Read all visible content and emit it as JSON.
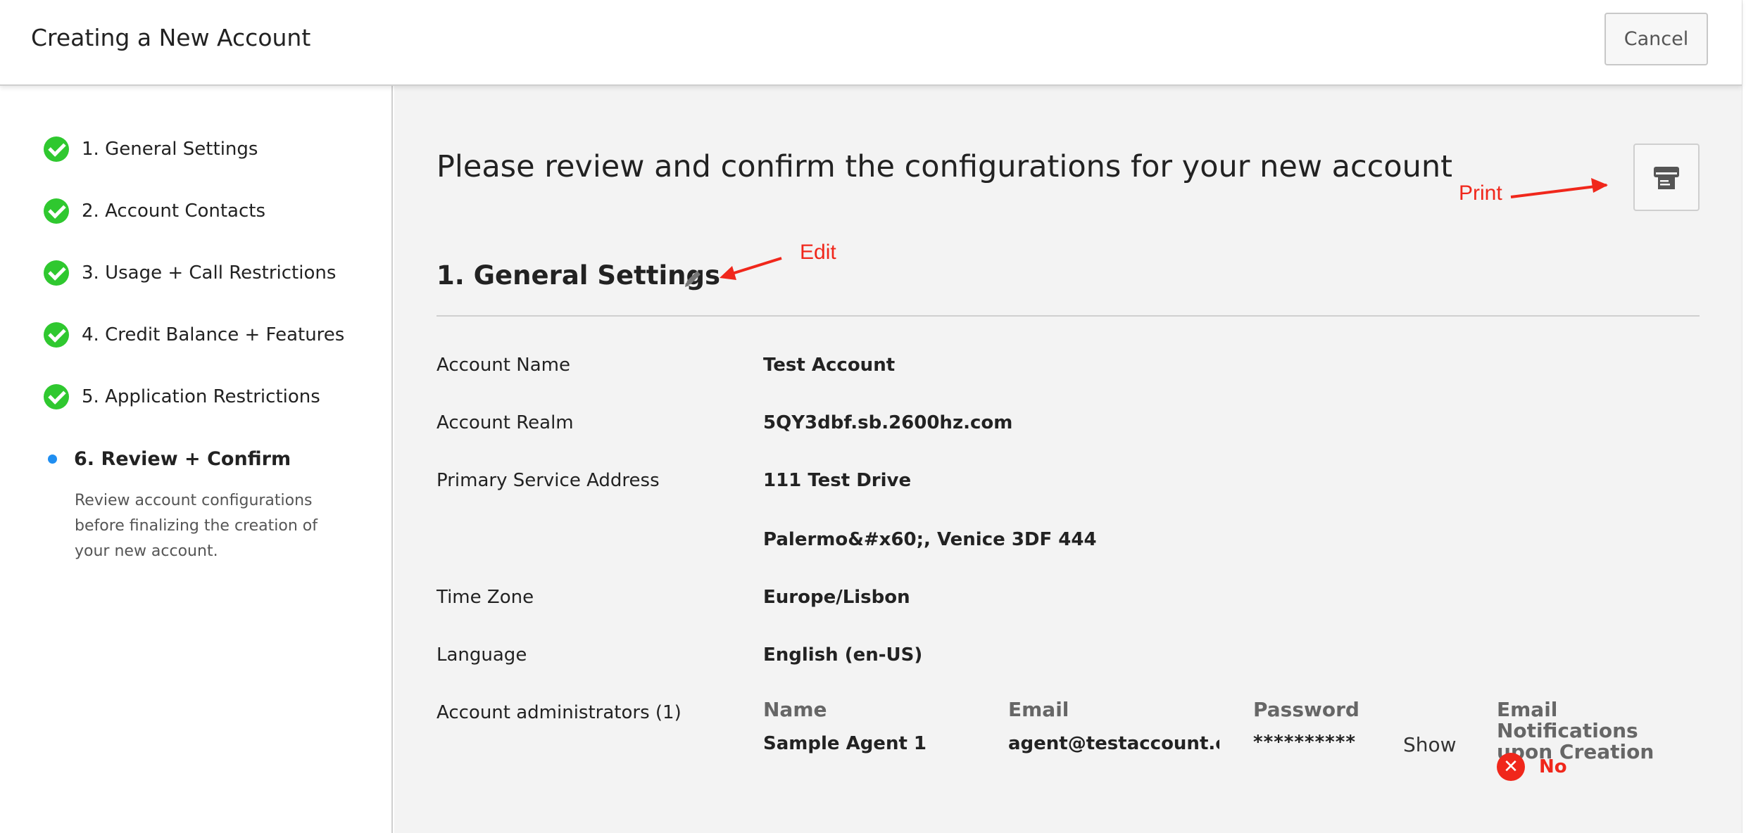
{
  "header": {
    "title": "Creating a New Account",
    "cancel_label": "Cancel"
  },
  "sidebar": {
    "steps": [
      {
        "label": "1. General Settings",
        "status": "complete"
      },
      {
        "label": "2. Account Contacts",
        "status": "complete"
      },
      {
        "label": "3. Usage + Call Restrictions",
        "status": "complete"
      },
      {
        "label": "4. Credit Balance + Features",
        "status": "complete"
      },
      {
        "label": "5. Application Restrictions",
        "status": "complete"
      },
      {
        "label": "6. Review + Confirm",
        "status": "active"
      }
    ],
    "active_description": "Review account configurations before finalizing the creation of your new account."
  },
  "main": {
    "heading": "Please review and confirm the configurations for your new account",
    "print_icon": "printer-icon",
    "annotations": {
      "print": "Print",
      "edit": "Edit"
    },
    "section": {
      "title": "1. General Settings",
      "edit_icon": "pencil-icon",
      "rows": [
        {
          "label": "Account Name",
          "value": "Test Account"
        },
        {
          "label": "Account Realm",
          "value": "5QY3dbf.sb.2600hz.com"
        },
        {
          "label": "Primary Service Address",
          "value": "111 Test Drive"
        },
        {
          "label": "",
          "value": "Palermo&#x60;, Venice 3DF 444"
        },
        {
          "label": "Time Zone",
          "value": "Europe/Lisbon"
        },
        {
          "label": "Language",
          "value": "English (en-US)"
        }
      ],
      "admins": {
        "label": "Account administrators (1)",
        "columns": [
          "Name",
          "Email",
          "Password",
          "Email Notifications upon Creation"
        ],
        "rows": [
          {
            "name": "Sample Agent 1",
            "email": "agent@testaccount.c…",
            "password": "**********",
            "show_label": "Show",
            "notifications": "No"
          }
        ]
      }
    }
  },
  "colors": {
    "check": "#2fc82f",
    "active_dot": "#1f8ef1",
    "annotation": "#f0271b",
    "content_bg": "#f3f3f3"
  }
}
